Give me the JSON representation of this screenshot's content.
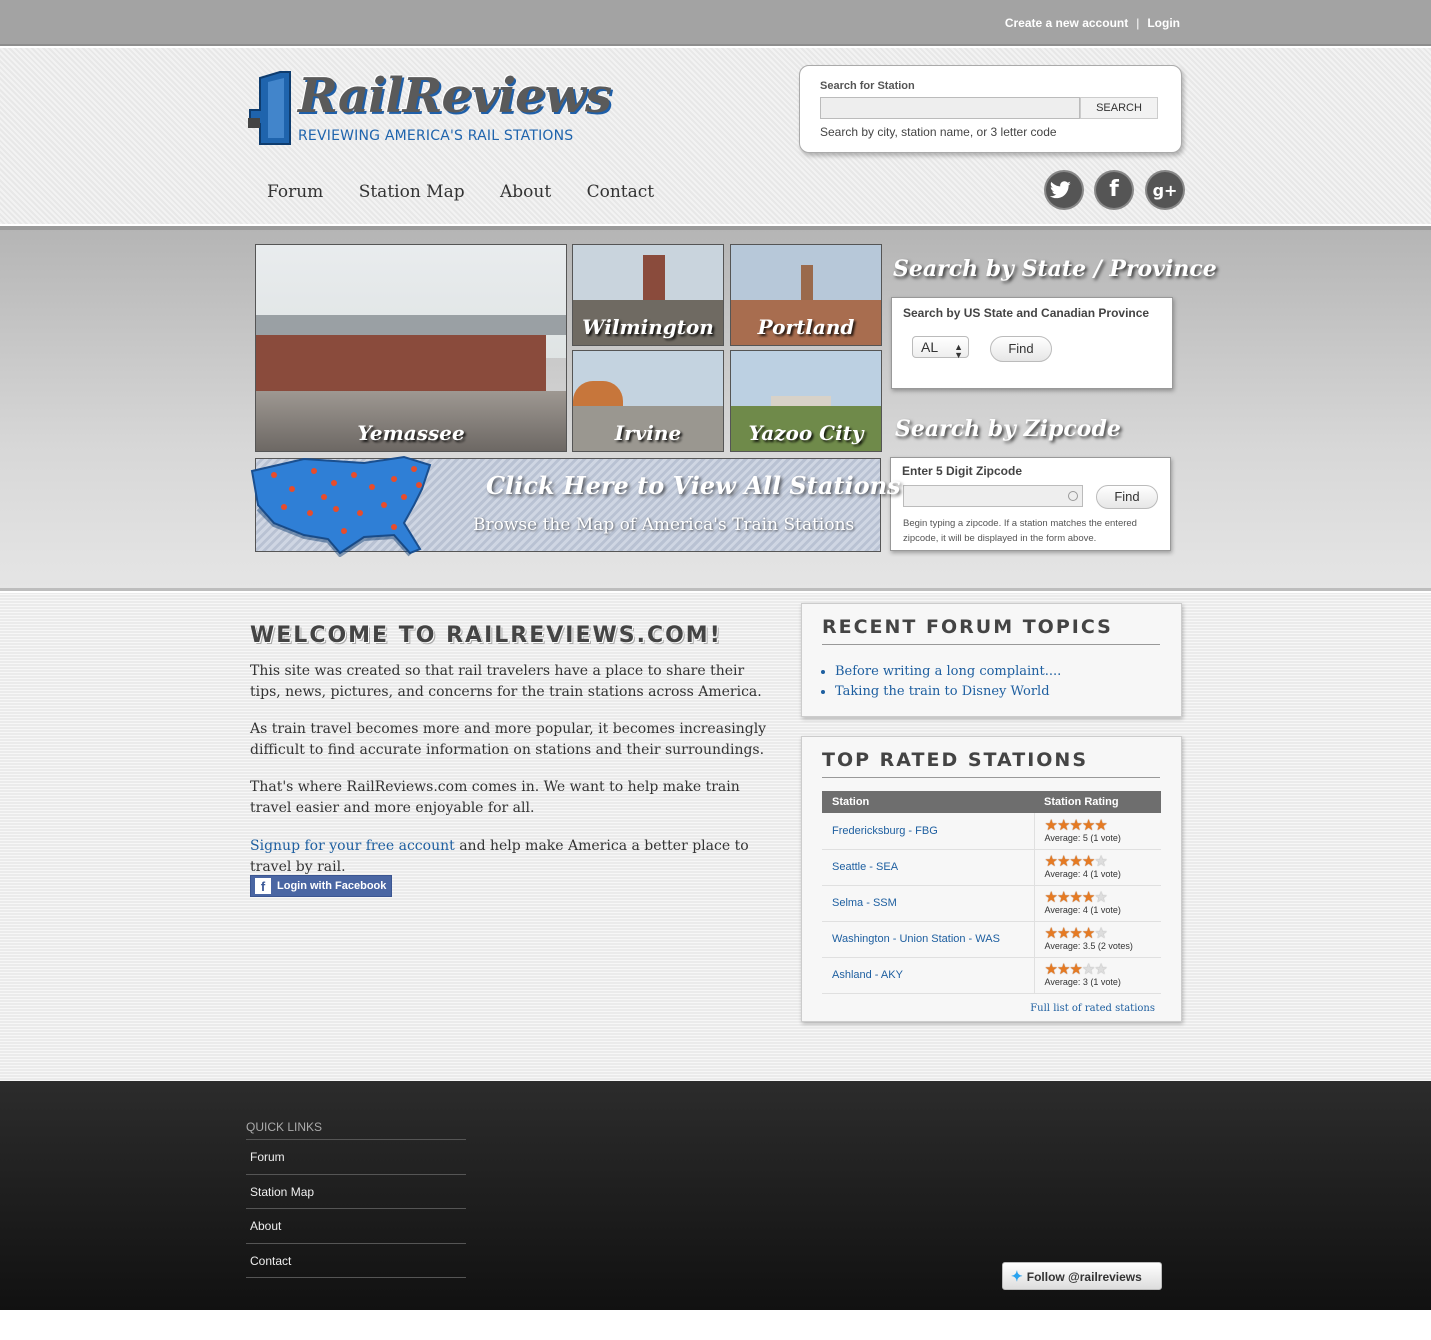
{
  "topbar": {
    "create_account": "Create a new account",
    "separator": "|",
    "login": "Login"
  },
  "logo": {
    "wordmark": "RailReviews",
    "tagline": "REVIEWING AMERICA'S RAIL STATIONS"
  },
  "search": {
    "label": "Search for Station",
    "value": "",
    "button": "SEARCH",
    "hint": "Search by city, station name, or 3 letter code"
  },
  "nav": [
    "Forum",
    "Station Map",
    "About",
    "Contact"
  ],
  "social": {
    "twitter": "twitter-icon",
    "facebook": "facebook-icon",
    "google": "google-plus-icon"
  },
  "tiles": [
    "Yemassee",
    "Wilmington",
    "Portland",
    "Irvine",
    "Yazoo City"
  ],
  "state_search": {
    "title": "Search by State / Province",
    "label": "Search by US State and Canadian Province",
    "selected": "AL",
    "button": "Find"
  },
  "zip_search": {
    "title": "Search by Zipcode",
    "label": "Enter 5 Digit Zipcode",
    "value": "",
    "button": "Find",
    "hint": "Begin typing a zipcode. If a station matches the entered zipcode, it will be displayed in the form above."
  },
  "map_banner": {
    "title": "Click Here to View All Stations",
    "subtitle": "Browse the Map of America's Train Stations"
  },
  "welcome": {
    "title": "WELCOME TO RAILREVIEWS.COM!",
    "p1": "This site was created so that rail travelers have a place to share their tips, news, pictures, and concerns for the train stations across America.",
    "p2": "As train travel becomes more and more popular, it becomes increasingly difficult to find accurate information on stations and their surroundings.",
    "p3": "That's where RailReviews.com comes in. We want to help make train travel easier and more enjoyable for all.",
    "signup_link": "Signup for your free account",
    "signup_rest": " and help make America a better place to travel by rail.",
    "fb_button": "Login with Facebook"
  },
  "forum": {
    "title": "RECENT FORUM TOPICS",
    "topics": [
      "Before writing a long complaint....",
      "Taking the train to Disney World"
    ]
  },
  "top_rated": {
    "title": "TOP RATED STATIONS",
    "col_station": "Station",
    "col_rating": "Station Rating",
    "rows": [
      {
        "station": "Fredericksburg - FBG",
        "rating": 5,
        "avg": "Average: 5 (1 vote)"
      },
      {
        "station": "Seattle - SEA",
        "rating": 4,
        "avg": "Average: 4 (1 vote)"
      },
      {
        "station": "Selma - SSM",
        "rating": 4,
        "avg": "Average: 4 (1 vote)"
      },
      {
        "station": "Washington - Union Station - WAS",
        "rating": 3.5,
        "avg": "Average: 3.5 (2 votes)"
      },
      {
        "station": "Ashland - AKY",
        "rating": 3,
        "avg": "Average: 3 (1 vote)"
      }
    ],
    "full_list": "Full list of rated stations"
  },
  "footer": {
    "quick_links_title": "QUICK LINKS",
    "links": [
      "Forum",
      "Station Map",
      "About",
      "Contact"
    ],
    "follow": "Follow @railreviews"
  }
}
